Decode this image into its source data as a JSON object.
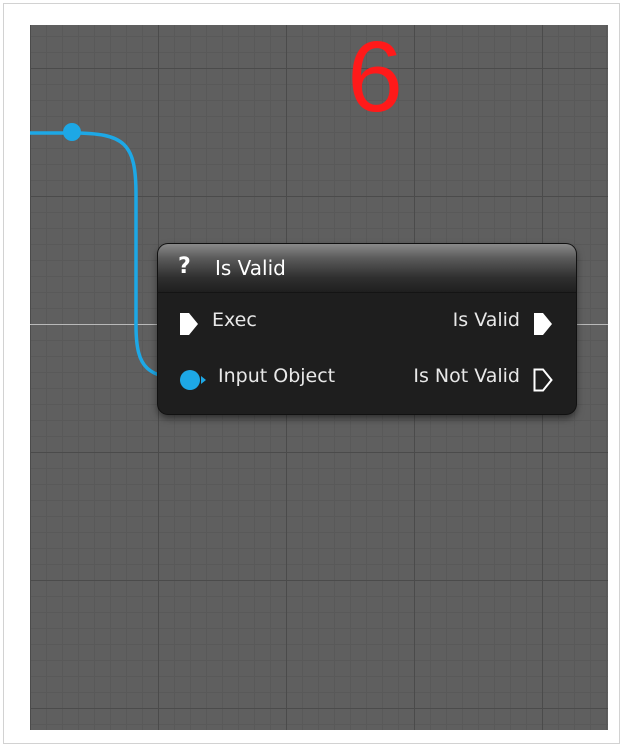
{
  "annotation": {
    "step_number": "6",
    "color": "#ff1a1a"
  },
  "node": {
    "header_icon": "question-mark-icon",
    "header_glyph": "?",
    "title": "Is Valid",
    "inputs": [
      {
        "label": "Exec",
        "pin": "exec-pin-icon",
        "connected": true
      },
      {
        "label": "Input Object",
        "pin": "object-pin-icon",
        "connected": true
      }
    ],
    "outputs": [
      {
        "label": "Is Valid",
        "pin": "exec-pin-icon",
        "connected": true
      },
      {
        "label": "Is Not Valid",
        "pin": "exec-pin-icon",
        "connected": false
      }
    ]
  },
  "colors": {
    "wire": "#1da8e6",
    "exec_pin": "#ffffff",
    "canvas": "#5f5f5f"
  }
}
